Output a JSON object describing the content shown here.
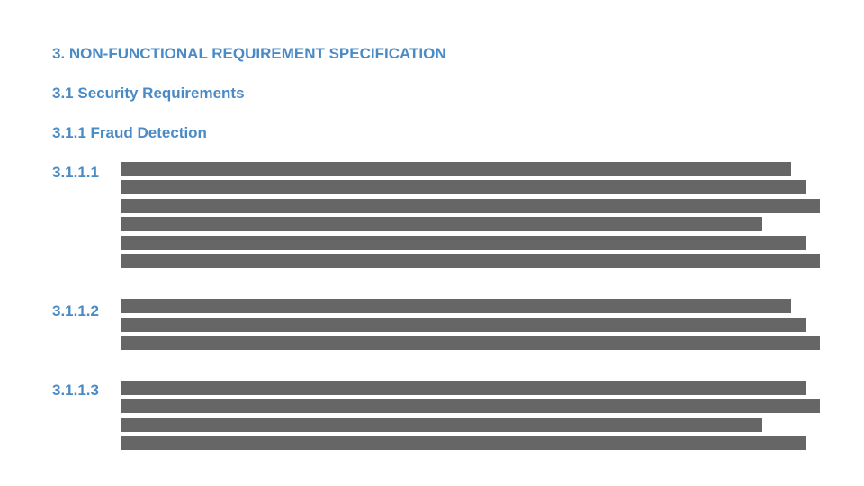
{
  "document": {
    "section_title": "3. NON-FUNCTIONAL REQUIREMENT SPECIFICATION",
    "subsection_title": "3.1 Security Requirements",
    "subsubsection_title": "3.1.1 Fraud Detection",
    "requirements": [
      {
        "id": "3.1.1.1",
        "redacted_lines": 6
      },
      {
        "id": "3.1.1.2",
        "redacted_lines": 3
      },
      {
        "id": "3.1.1.3",
        "redacted_lines": 4
      }
    ]
  },
  "colors": {
    "heading": "#4a8bc6",
    "redaction_bar": "#666666",
    "background": "#ffffff"
  }
}
